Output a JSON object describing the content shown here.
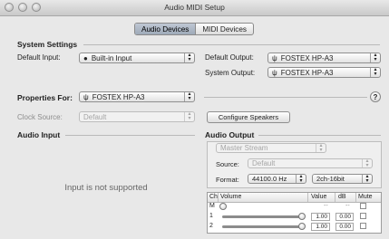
{
  "window": {
    "title": "Audio MIDI Setup"
  },
  "tabs": [
    {
      "label": "Audio Devices",
      "selected": true
    },
    {
      "label": "MIDI Devices",
      "selected": false
    }
  ],
  "system_settings": {
    "heading": "System Settings",
    "default_input_label": "Default Input:",
    "default_input_value": "Built-in Input",
    "default_output_label": "Default Output:",
    "default_output_value": "FOSTEX HP-A3",
    "system_output_label": "System Output:",
    "system_output_value": "FOSTEX HP-A3"
  },
  "properties": {
    "label": "Properties For:",
    "device": "FOSTEX HP-A3",
    "help": "?",
    "clock_source_label": "Clock Source:",
    "clock_source_value": "Default",
    "configure_speakers": "Configure Speakers"
  },
  "audio_input": {
    "heading": "Audio Input",
    "message": "Input is not supported"
  },
  "audio_output": {
    "heading": "Audio Output",
    "stream": "Master Stream",
    "source_label": "Source:",
    "source_value": "Default",
    "format_label": "Format:",
    "format_rate": "44100.0 Hz",
    "format_bits": "2ch-16bit",
    "table": {
      "headers": {
        "ch": "Ch",
        "volume": "Volume",
        "value": "Value",
        "db": "dB",
        "mute": "Mute"
      },
      "rows": [
        {
          "ch": "M",
          "value": "--",
          "db": "--",
          "level": 0.0
        },
        {
          "ch": "1",
          "value": "1.00",
          "db": "0.00",
          "level": 1.0
        },
        {
          "ch": "2",
          "value": "1.00",
          "db": "0.00",
          "level": 1.0
        }
      ]
    }
  }
}
